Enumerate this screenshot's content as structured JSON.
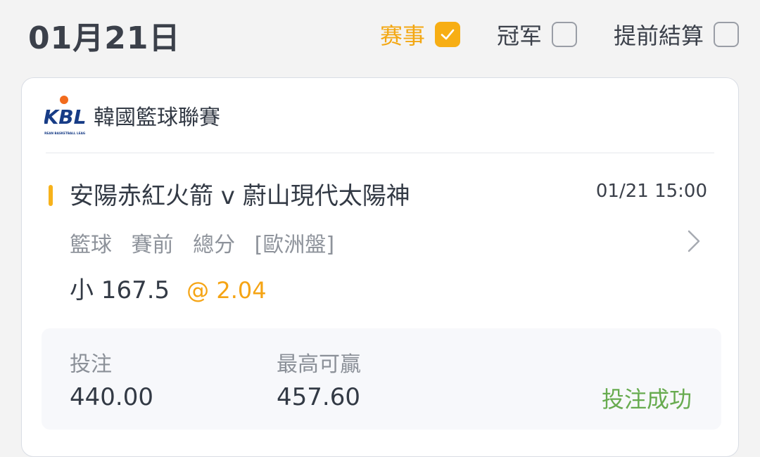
{
  "header": {
    "date": "01月21日",
    "filters": [
      {
        "label": "赛事",
        "checked": true
      },
      {
        "label": "冠军",
        "checked": false
      },
      {
        "label": "提前結算",
        "checked": false
      }
    ]
  },
  "league": {
    "logo_text": "KBL",
    "logo_subtext": "KOREAN BASKETBALL LEAGUE",
    "name": "韓國籃球聯賽"
  },
  "match": {
    "title": "安陽赤紅火箭 v 蔚山現代太陽神",
    "time": "01/21 15:00",
    "sport": "籃球",
    "stage": "賽前",
    "market": "總分",
    "odds_type": "[歐洲盤]",
    "pick": "小 167.5",
    "odds": "@ 2.04"
  },
  "bet": {
    "stake_label": "投注",
    "stake_value": "440.00",
    "max_win_label": "最高可贏",
    "max_win_value": "457.60",
    "status": "投注成功"
  },
  "colors": {
    "accent": "#f7ae14",
    "success": "#67ab4f",
    "muted": "#8e939b"
  }
}
